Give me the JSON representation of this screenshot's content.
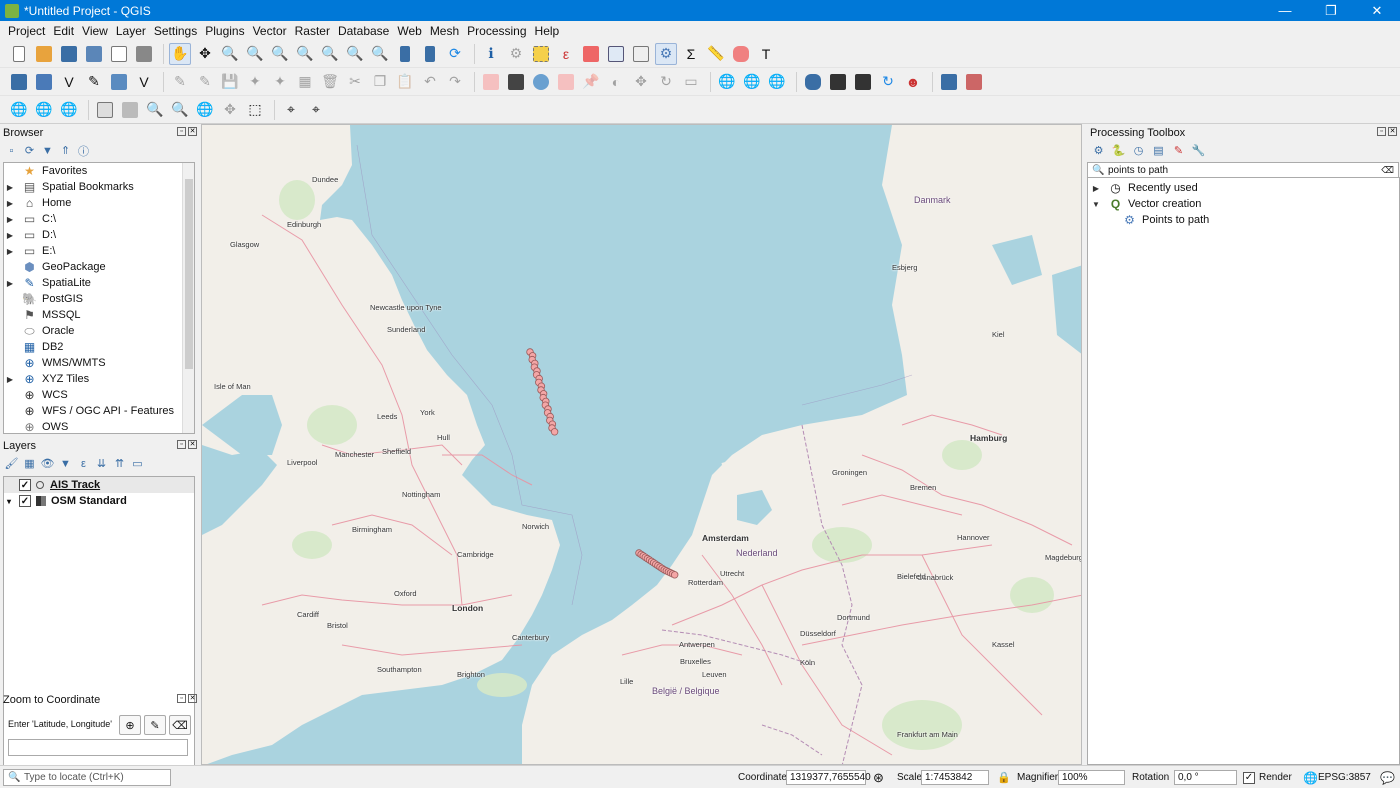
{
  "window": {
    "title": "*Untitled Project - QGIS",
    "minimize": "—",
    "maximize": "❐",
    "close": "✕"
  },
  "menu": [
    "Project",
    "Edit",
    "View",
    "Layer",
    "Settings",
    "Plugins",
    "Vector",
    "Raster",
    "Database",
    "Web",
    "Mesh",
    "Processing",
    "Help"
  ],
  "browser": {
    "title": "Browser",
    "items": [
      {
        "label": "Favorites",
        "icon": "star-icon",
        "expandable": false
      },
      {
        "label": "Spatial Bookmarks",
        "icon": "bookmark-icon",
        "expandable": true
      },
      {
        "label": "Home",
        "icon": "home-folder-icon",
        "expandable": true
      },
      {
        "label": "C:\\",
        "icon": "folder-icon",
        "expandable": true
      },
      {
        "label": "D:\\",
        "icon": "folder-icon",
        "expandable": true
      },
      {
        "label": "E:\\",
        "icon": "folder-icon",
        "expandable": true
      },
      {
        "label": "GeoPackage",
        "icon": "geopackage-icon",
        "expandable": false
      },
      {
        "label": "SpatiaLite",
        "icon": "spatialite-icon",
        "expandable": true
      },
      {
        "label": "PostGIS",
        "icon": "postgis-icon",
        "expandable": false
      },
      {
        "label": "MSSQL",
        "icon": "mssql-icon",
        "expandable": false
      },
      {
        "label": "Oracle",
        "icon": "oracle-icon",
        "expandable": false
      },
      {
        "label": "DB2",
        "icon": "db2-icon",
        "expandable": false
      },
      {
        "label": "WMS/WMTS",
        "icon": "wms-icon",
        "expandable": false
      },
      {
        "label": "XYZ Tiles",
        "icon": "xyz-icon",
        "expandable": true
      },
      {
        "label": "WCS",
        "icon": "wcs-icon",
        "expandable": false
      },
      {
        "label": "WFS / OGC API - Features",
        "icon": "wfs-icon",
        "expandable": false
      },
      {
        "label": "OWS",
        "icon": "ows-icon",
        "expandable": false
      }
    ]
  },
  "layers": {
    "title": "Layers",
    "items": [
      {
        "label": "AIS Track",
        "checked": true,
        "icon": "point-layer-icon"
      },
      {
        "label": "OSM Standard",
        "checked": true,
        "icon": "raster-layer-icon"
      }
    ]
  },
  "zoom_to_coordinate": {
    "title": "Zoom to Coordinate",
    "label": "Enter 'Latitude, Longitude'",
    "value": ""
  },
  "processing": {
    "title": "Processing Toolbox",
    "search": "points to path",
    "groups": [
      {
        "label": "Recently used",
        "expanded": false
      },
      {
        "label": "Vector creation",
        "expanded": true,
        "children": [
          "Points to path"
        ]
      }
    ]
  },
  "map": {
    "colors": {
      "sea": "#aad3df",
      "land": "#f2efe9",
      "road": "#e892a2",
      "track": "#f4a6a6"
    },
    "labels": {
      "dundee": "Dundee",
      "edinburgh": "Edinburgh",
      "glasgow": "Glasgow",
      "newcastle": "Newcastle upon Tyne",
      "sunderland": "Sunderland",
      "isleofman": "Isle of Man",
      "leeds": "Leeds",
      "york": "York",
      "manchester": "Manchester",
      "liverpool": "Liverpool",
      "sheffield": "Sheffield",
      "hull": "Hull",
      "nottingham": "Nottingham",
      "birmingham": "Birmingham",
      "norwich": "Norwich",
      "cambridge": "Cambridge",
      "oxford": "Oxford",
      "london": "London",
      "cardiff": "Cardiff",
      "bristol": "Bristol",
      "southampton": "Southampton",
      "brighton": "Brighton",
      "canterbury": "Canterbury",
      "lille": "Lille",
      "danmark": "Danmark",
      "hamburg": "Hamburg",
      "bremen": "Bremen",
      "amsterdam": "Amsterdam",
      "nederland": "Nederland",
      "utrecht": "Utrecht",
      "rotterdam": "Rotterdam",
      "hannover": "Hannover",
      "magdeburg": "Magdeburg",
      "dusseldorf": "Düsseldorf",
      "koln": "Köln",
      "bruxelles": "Bruxelles",
      "belgie": "België / Belgique",
      "antwerpen": "Antwerpen",
      "frankfurt": "Frankfurt am Main",
      "esbjerg": "Esbjerg",
      "kiel": "Kiel",
      "groningen": "Groningen",
      "osnabruck": "Osnabrück",
      "dortmund": "Dortmund",
      "bielefeld": "Bielefeld",
      "kassel": "Kassel",
      "leuven": "Leuven"
    }
  },
  "status": {
    "locator_placeholder": "Type to locate (Ctrl+K)",
    "coordinate_label": "Coordinate",
    "coordinate": "1319377,7655540",
    "scale_label": "Scale",
    "scale": "1:7453842",
    "magnifier_label": "Magnifier",
    "magnifier": "100%",
    "rotation_label": "Rotation",
    "rotation": "0,0 °",
    "render_label": "Render",
    "crs": "EPSG:3857"
  }
}
